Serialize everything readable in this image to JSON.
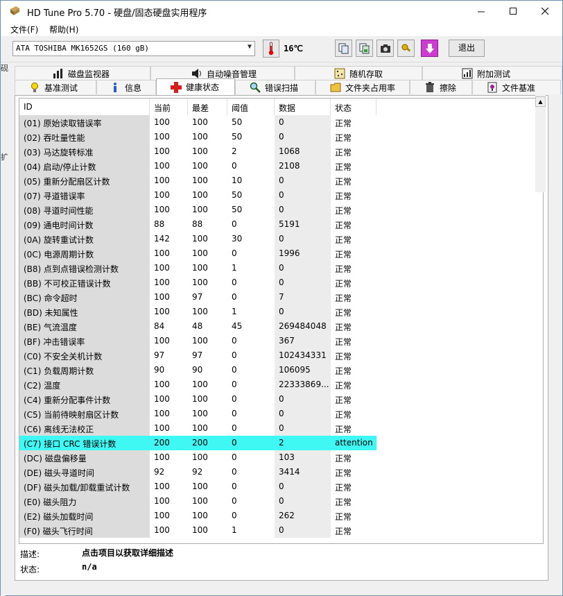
{
  "window": {
    "title": "HD Tune Pro 5.70 - 硬盘/固态硬盘实用程序"
  },
  "menu": {
    "file": "文件(F)",
    "help": "帮助(H)"
  },
  "toolbar": {
    "drive": "ATA     TOSHIBA MK1652GS (160 gB)",
    "temperature": "16℃",
    "exit_label": "退出"
  },
  "left_stub": {
    "chars": [
      "砚",
      "扩"
    ]
  },
  "tabs_row1": [
    {
      "label": "磁盘监视器",
      "icon": "disk-monitor-icon"
    },
    {
      "label": "自动噪音管理",
      "icon": "speaker-icon"
    },
    {
      "label": "随机存取",
      "icon": "random-access-icon"
    },
    {
      "label": "附加测试",
      "icon": "extra-tests-icon"
    }
  ],
  "tabs_row2": [
    {
      "label": "基准测试",
      "icon": "benchmark-icon"
    },
    {
      "label": "信息",
      "icon": "info-icon"
    },
    {
      "label": "健康状态",
      "icon": "health-icon",
      "active": true
    },
    {
      "label": "错误扫描",
      "icon": "error-scan-icon"
    },
    {
      "label": "文件夹占用率",
      "icon": "folder-usage-icon"
    },
    {
      "label": "擦除",
      "icon": "erase-icon"
    },
    {
      "label": "文件基准",
      "icon": "file-benchmark-icon"
    }
  ],
  "table": {
    "columns": [
      "ID",
      "当前",
      "最差",
      "阈值",
      "数据",
      "状态"
    ],
    "rows": [
      [
        "(01) 原始读取错误率",
        "100",
        "100",
        "50",
        "0",
        "正常"
      ],
      [
        "(02) 吞吐量性能",
        "100",
        "100",
        "50",
        "0",
        "正常"
      ],
      [
        "(03) 马达旋转标准",
        "100",
        "100",
        "2",
        "1068",
        "正常"
      ],
      [
        "(04) 启动/停止计数",
        "100",
        "100",
        "0",
        "2108",
        "正常"
      ],
      [
        "(05) 重新分配扇区计数",
        "100",
        "100",
        "10",
        "0",
        "正常"
      ],
      [
        "(07) 寻道错误率",
        "100",
        "100",
        "50",
        "0",
        "正常"
      ],
      [
        "(08) 寻道时间性能",
        "100",
        "100",
        "50",
        "0",
        "正常"
      ],
      [
        "(09) 通电时间计数",
        "88",
        "88",
        "0",
        "5191",
        "正常"
      ],
      [
        "(0A) 旋转重试计数",
        "142",
        "100",
        "30",
        "0",
        "正常"
      ],
      [
        "(0C) 电源周期计数",
        "100",
        "100",
        "0",
        "1996",
        "正常"
      ],
      [
        "(B8) 点到点错误检测计数",
        "100",
        "100",
        "1",
        "0",
        "正常"
      ],
      [
        "(BB) 不可校正错误计数",
        "100",
        "100",
        "0",
        "0",
        "正常"
      ],
      [
        "(BC) 命令超时",
        "100",
        "97",
        "0",
        "7",
        "正常"
      ],
      [
        "(BD) 未知属性",
        "100",
        "100",
        "1",
        "0",
        "正常"
      ],
      [
        "(BE) 气流温度",
        "84",
        "48",
        "45",
        "269484048",
        "正常"
      ],
      [
        "(BF) 冲击错误率",
        "100",
        "100",
        "0",
        "367",
        "正常"
      ],
      [
        "(C0) 不安全关机计数",
        "97",
        "97",
        "0",
        "102434331",
        "正常"
      ],
      [
        "(C1) 负载周期计数",
        "90",
        "90",
        "0",
        "106095",
        "正常"
      ],
      [
        "(C2) 温度",
        "100",
        "100",
        "0",
        "22333869...",
        "正常"
      ],
      [
        "(C4) 重新分配事件计数",
        "100",
        "100",
        "0",
        "0",
        "正常"
      ],
      [
        "(C5) 当前待映射扇区计数",
        "100",
        "100",
        "0",
        "0",
        "正常"
      ],
      [
        "(C6) 离线无法校正",
        "100",
        "100",
        "0",
        "0",
        "正常"
      ],
      [
        "(C7) 接口 CRC 错误计数",
        "200",
        "200",
        "0",
        "2",
        "attention"
      ],
      [
        "(DC) 磁盘偏移量",
        "100",
        "100",
        "0",
        "103",
        "正常"
      ],
      [
        "(DE) 磁头寻道时间",
        "92",
        "92",
        "0",
        "3414",
        "正常"
      ],
      [
        "(DF) 磁头加载/卸载重试计数",
        "100",
        "100",
        "0",
        "0",
        "正常"
      ],
      [
        "(E0) 磁头阻力",
        "100",
        "100",
        "0",
        "0",
        "正常"
      ],
      [
        "(E2) 磁头加载时间",
        "100",
        "100",
        "0",
        "262",
        "正常"
      ],
      [
        "(F0) 磁头飞行时间",
        "100",
        "100",
        "1",
        "0",
        "正常"
      ]
    ],
    "highlight_row": 22,
    "highlight_color": "#3ff7f3"
  },
  "footer": {
    "desc_label": "描述:",
    "desc_value": "点击项目以获取详细描述",
    "status_label": "状态:",
    "status_value": "n/a"
  }
}
